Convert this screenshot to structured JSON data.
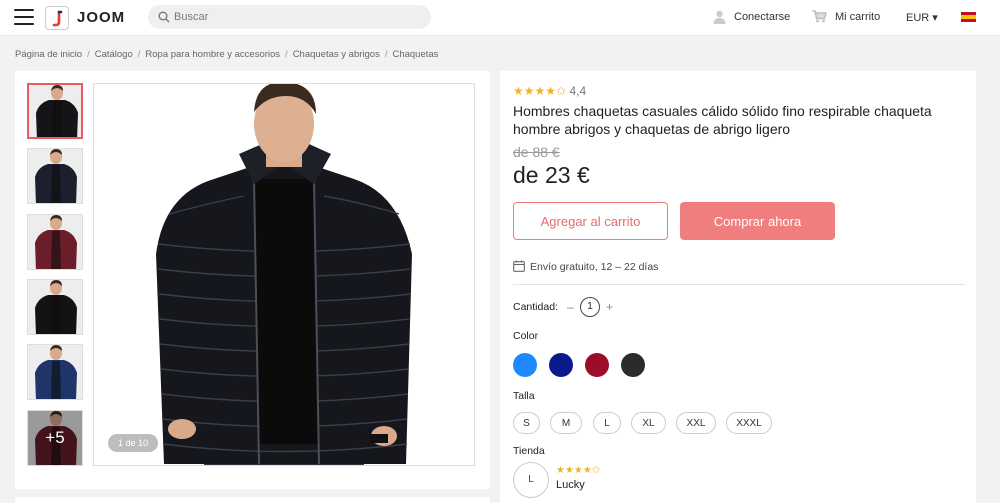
{
  "header": {
    "logo_text": "JOOM",
    "search_placeholder": "Buscar",
    "login_label": "Conectarse",
    "cart_label": "Mi carrito",
    "currency_label": "EUR ▾"
  },
  "breadcrumb": [
    "Página de inicio",
    "Catálogo",
    "Ropa para hombre y accesorios",
    "Chaquetas y abrigos",
    "Chaquetas"
  ],
  "gallery": {
    "thumbnails": [
      {
        "color": "#141518",
        "active": true
      },
      {
        "color": "#1b1f2e",
        "active": false
      },
      {
        "color": "#6b1e2a",
        "active": false
      },
      {
        "color": "#131313",
        "active": false
      },
      {
        "color": "#1f3468",
        "active": false
      },
      {
        "color": "#6b1e2a",
        "active": false,
        "overlay": "+5"
      }
    ],
    "counter": "1 de 10"
  },
  "product": {
    "stars": "★★★★✩",
    "rating": "4,4",
    "title": "Hombres chaquetas casuales cálido sólido fino respirable chaqueta hombre abrigos y chaquetas de abrigo ligero",
    "old_price": "de 88 €",
    "price": "de 23 €",
    "add_to_cart": "Agregar al carrito",
    "buy_now": "Comprar ahora",
    "shipping": "Envío gratuito, 12 – 22 días",
    "quantity_label": "Cantidad:",
    "quantity_minus": "–",
    "quantity_value": "1",
    "quantity_plus": "+",
    "color_label": "Color",
    "colors": [
      {
        "name": "light-blue",
        "hex": "#1e88ff"
      },
      {
        "name": "navy",
        "hex": "#0a1a8a"
      },
      {
        "name": "burgundy",
        "hex": "#9c0d2a"
      },
      {
        "name": "black",
        "hex": "#2b2b2b"
      }
    ],
    "size_label": "Talla",
    "sizes": [
      "S",
      "M",
      "L",
      "XL",
      "XXL",
      "XXXL"
    ],
    "store_label": "Tienda",
    "store_avatar": "L",
    "store_stars": "★★★★✩",
    "store_name": "Lucky"
  },
  "colors": {
    "accent": "#f07e7e",
    "accent_text": "#e86a6a"
  }
}
